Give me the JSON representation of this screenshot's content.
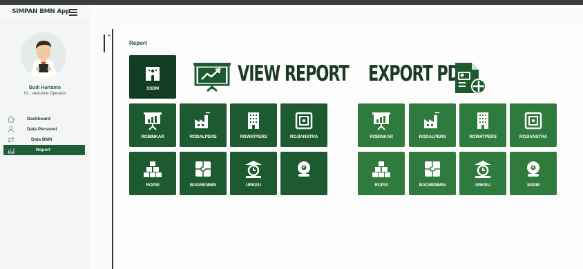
{
  "app": {
    "title": "SIMPAN BMN App"
  },
  "profile": {
    "name": "Budi Hartanto",
    "greeting": "Hi... welcome Operator"
  },
  "nav": [
    {
      "label": "Dashboard",
      "icon": "home-icon",
      "active": false
    },
    {
      "label": "Data Personel",
      "icon": "user-icon",
      "active": false
    },
    {
      "label": "Data BMN",
      "icon": "transfer-icon",
      "active": false
    },
    {
      "label": "Report",
      "icon": "chart-icon",
      "active": true
    }
  ],
  "page": {
    "breadcrumb": "Report"
  },
  "view_report": {
    "title": "VIEW REPORT",
    "featured": {
      "label": "SSDM",
      "icon": "ssdm-icon"
    },
    "tiles": [
      {
        "label": "ROBINKAR",
        "icon": "presentation-chart-icon"
      },
      {
        "label": "RODALPERS",
        "icon": "factory-icon"
      },
      {
        "label": "ROWATPERS",
        "icon": "building-icon"
      },
      {
        "label": "ROJIANSTRA",
        "icon": "safe-icon"
      },
      {
        "label": "ROPSI",
        "icon": "boxes-icon"
      },
      {
        "label": "BAGRENMIN",
        "icon": "puzzle-icon"
      },
      {
        "label": "URKEU",
        "icon": "finance-icon"
      },
      {
        "label": "",
        "icon": "alarm-bell-icon"
      }
    ]
  },
  "export_pdf": {
    "title": "EXPORT PDF",
    "tiles": [
      {
        "label": "ROBINKAR",
        "icon": "presentation-chart-icon"
      },
      {
        "label": "RODALPERS",
        "icon": "factory-icon"
      },
      {
        "label": "ROWATPERS",
        "icon": "building-icon"
      },
      {
        "label": "ROJIANSTRA",
        "icon": "safe-icon"
      },
      {
        "label": "ROPSI",
        "icon": "boxes-icon"
      },
      {
        "label": "BAGRENMIN",
        "icon": "puzzle-icon"
      },
      {
        "label": "URKEU",
        "icon": "finance-icon"
      },
      {
        "label": "SSDM",
        "icon": "alarm-bell-icon"
      }
    ]
  },
  "colors": {
    "tile": "#1e5a2f",
    "tile_dark": "#133d22",
    "accent": "#1f5c38",
    "title": "#1a3a26"
  }
}
